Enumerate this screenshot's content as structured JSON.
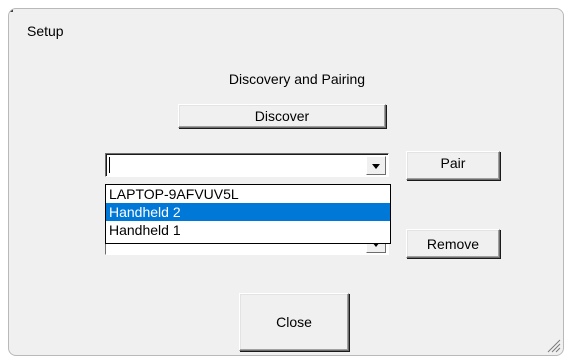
{
  "window": {
    "title": "Setup"
  },
  "main": {
    "section_label": "Discovery and Pairing",
    "discover_label": "Discover",
    "pair_label": "Pair",
    "remove_label": "Remove",
    "close_label": "Close"
  },
  "device_combo": {
    "value": "",
    "dropdown_open": true,
    "options": [
      {
        "label": "LAPTOP-9AFVUV5L",
        "selected": false
      },
      {
        "label": "Handheld 2",
        "selected": true
      },
      {
        "label": "Handheld 1",
        "selected": false
      }
    ]
  },
  "paired_combo": {
    "value": ""
  },
  "colors": {
    "dialog_bg": "#f0f0f0",
    "selection": "#0078d7"
  }
}
